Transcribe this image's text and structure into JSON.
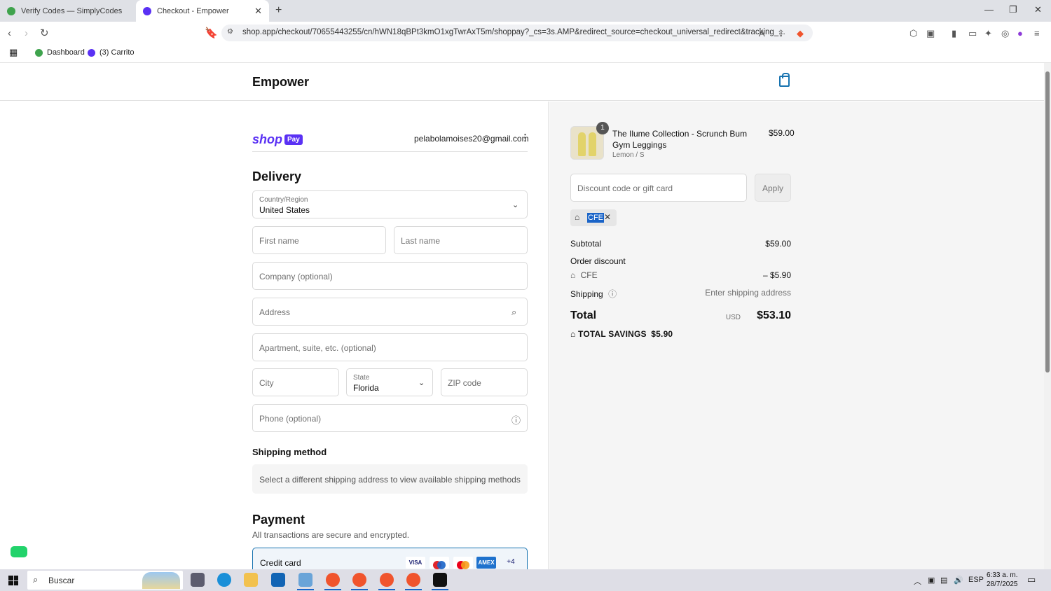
{
  "browser": {
    "tabs": [
      {
        "title": "Verify Codes — SimplyCodes",
        "active": false,
        "favicon_color": "#3fa34d"
      },
      {
        "title": "Checkout - Empower",
        "active": true,
        "favicon_color": "#5a31f4"
      }
    ],
    "url": "shop.app/checkout/70655443255/cn/hWN18qBPt3kmO1xgTwrAxT5m/shoppay?_cs=3s.AMP&redirect_source=checkout_universal_redirect&tracking_...",
    "bookmarks": [
      {
        "label": "Dashboard",
        "icon_color": "#3fa34d"
      },
      {
        "label": "(3) Carrito",
        "icon_color": "#5a31f4"
      }
    ],
    "brave_badge": "4"
  },
  "header": {
    "brand": "Empower"
  },
  "account": {
    "shop": "shop",
    "pay": "Pay",
    "email": "pelabolamoises20@gmail.com"
  },
  "delivery": {
    "title": "Delivery",
    "country_label": "Country/Region",
    "country_value": "United States",
    "first_name_ph": "First name",
    "last_name_ph": "Last name",
    "company_ph": "Company (optional)",
    "address_ph": "Address",
    "apartment_ph": "Apartment, suite, etc. (optional)",
    "city_ph": "City",
    "state_label": "State",
    "state_value": "Florida",
    "zip_ph": "ZIP code",
    "phone_ph": "Phone (optional)"
  },
  "shipping_method": {
    "title": "Shipping method",
    "message": "Select a different shipping address to view available shipping methods"
  },
  "payment": {
    "title": "Payment",
    "subtitle": "All transactions are secure and encrypted.",
    "credit_card_label": "Credit card",
    "cards": [
      "VISA",
      "Maestro",
      "Mastercard",
      "AMEX"
    ],
    "more_cards": "+4"
  },
  "summary": {
    "product": {
      "quantity": "1",
      "name": "The Ilume Collection - Scrunch Bum Gym Leggings",
      "variant": "Lemon / S",
      "price": "$59.00"
    },
    "discount_ph": "Discount code or gift card",
    "apply_label": "Apply",
    "applied_code": "CFE",
    "subtotal_label": "Subtotal",
    "subtotal_value": "$59.00",
    "order_discount_label": "Order discount",
    "discount_code": "CFE",
    "discount_value": "– $5.90",
    "shipping_label": "Shipping",
    "shipping_value": "Enter shipping address",
    "total_label": "Total",
    "currency": "USD",
    "total_value": "$53.10",
    "savings_label": "TOTAL SAVINGS",
    "savings_value": "$5.90"
  },
  "taskbar": {
    "search_placeholder": "Buscar",
    "language": "ESP",
    "time": "6:33 a. m.",
    "date": "28/7/2025"
  }
}
